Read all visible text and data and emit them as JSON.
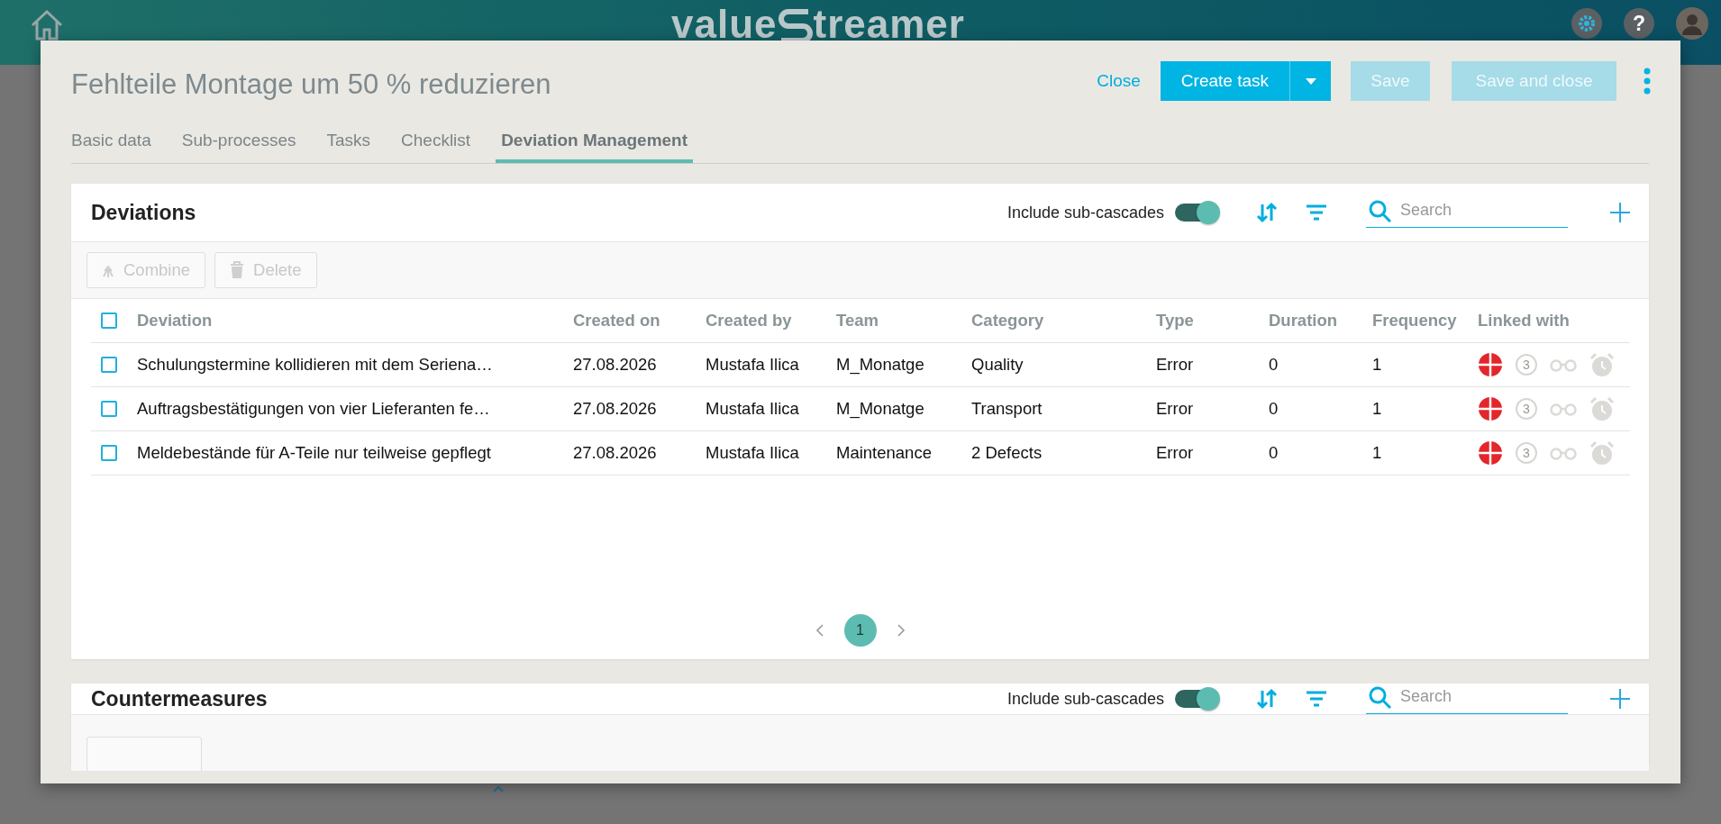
{
  "app_bar": {
    "logo_start": "value",
    "logo_end": "treamer",
    "help_label": "?"
  },
  "dialog": {
    "title": "Fehlteile Montage um 50 % reduzieren",
    "actions": [
      {
        "kind": "link",
        "label": "Close",
        "disabled": false
      },
      {
        "kind": "split",
        "label": "Create task",
        "disabled": false
      },
      {
        "kind": "button",
        "label": "Save",
        "disabled": true
      },
      {
        "kind": "button",
        "label": "Save and close",
        "disabled": true
      },
      {
        "kind": "more",
        "disabled": false
      }
    ]
  },
  "tabs": [
    {
      "label": "Basic data",
      "selected": false
    },
    {
      "label": "Sub-processes",
      "selected": false
    },
    {
      "label": "Tasks",
      "selected": false
    },
    {
      "label": "Checklist",
      "selected": false
    },
    {
      "label": "Deviation Management",
      "selected": true
    }
  ],
  "deviations": {
    "title": "Deviations",
    "toggle": {
      "label": "Include sub-cascades",
      "on": true
    },
    "search": {
      "placeholder": "Search"
    },
    "toolbar": [
      {
        "kind": "combine",
        "label": "Combine",
        "disabled": true
      },
      {
        "kind": "delete",
        "label": "Delete",
        "disabled": true
      }
    ],
    "table": {
      "select_all": {
        "checked": false
      },
      "columns": [
        "Deviation",
        "Created on",
        "Created by",
        "Team",
        "Category",
        "Type",
        "Duration",
        "Frequency",
        "Linked with"
      ],
      "rows": [
        {
          "checked": false,
          "cells": [
            "Schulungstermine kollidieren mit dem Seriena…",
            "27.08.2026",
            "Mustafa Ilica",
            "M_Monatge",
            "Quality",
            "Error",
            "0",
            "1"
          ],
          "links": [
            {
              "kind": "plan",
              "active": true
            },
            {
              "kind": "count",
              "label": "3",
              "active": false
            },
            {
              "kind": "glasses",
              "active": false
            },
            {
              "kind": "alarm",
              "active": false
            }
          ]
        },
        {
          "checked": false,
          "cells": [
            "Auftragsbestätigungen von vier Lieferanten fe…",
            "27.08.2026",
            "Mustafa Ilica",
            "M_Monatge",
            "Transport",
            "Error",
            "0",
            "1"
          ],
          "links": [
            {
              "kind": "plan",
              "active": true
            },
            {
              "kind": "count",
              "label": "3",
              "active": false
            },
            {
              "kind": "glasses",
              "active": false
            },
            {
              "kind": "alarm",
              "active": false
            }
          ]
        },
        {
          "checked": false,
          "cells": [
            "Meldebestände für A-Teile nur teilweise gepflegt",
            "27.08.2026",
            "Mustafa Ilica",
            "Maintenance",
            "2 Defects",
            "Error",
            "0",
            "1"
          ],
          "links": [
            {
              "kind": "plan",
              "active": true
            },
            {
              "kind": "count",
              "label": "3",
              "active": false
            },
            {
              "kind": "glasses",
              "active": false
            },
            {
              "kind": "alarm",
              "active": false
            }
          ]
        }
      ]
    },
    "pagination": {
      "pages": [
        {
          "label": "1",
          "selected": true
        }
      ]
    }
  },
  "countermeasures": {
    "title": "Countermeasures",
    "toggle": {
      "label": "Include sub-cascades",
      "on": true
    },
    "search": {
      "placeholder": "Search"
    }
  }
}
